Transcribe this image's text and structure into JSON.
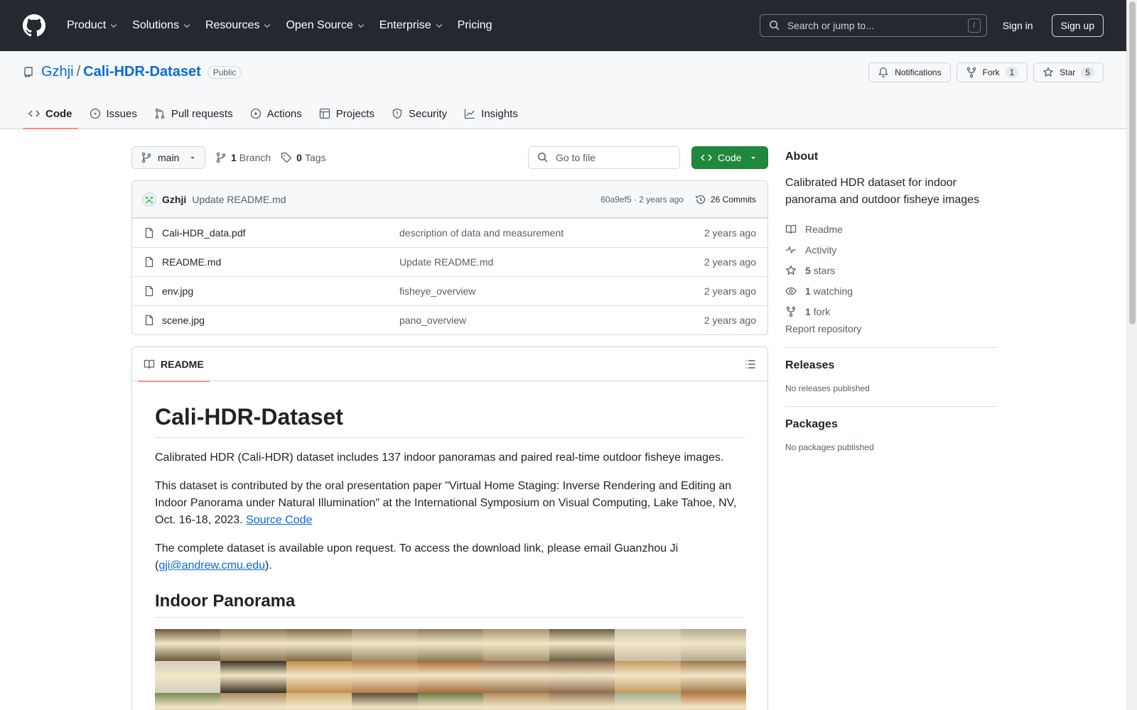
{
  "header": {
    "nav": [
      "Product",
      "Solutions",
      "Resources",
      "Open Source",
      "Enterprise",
      "Pricing"
    ],
    "search_placeholder": "Search or jump to...",
    "search_key": "/",
    "sign_in": "Sign in",
    "sign_up": "Sign up"
  },
  "repo": {
    "owner": "Gzhji",
    "separator": "/",
    "name": "Cali-HDR-Dataset",
    "visibility": "Public",
    "notifications_label": "Notifications",
    "fork_label": "Fork",
    "fork_count": "1",
    "star_label": "Star",
    "star_count": "5",
    "tabs": [
      "Code",
      "Issues",
      "Pull requests",
      "Actions",
      "Projects",
      "Security",
      "Insights"
    ]
  },
  "toolbar": {
    "branch": "main",
    "branch_count": "1",
    "branch_label": "Branch",
    "tag_count": "0",
    "tag_label": "Tags",
    "goto_placeholder": "Go to file",
    "code_label": "Code"
  },
  "latest_commit": {
    "author": "Gzhji",
    "message": "Update README.md",
    "meta": "60a9ef5 · 2 years ago",
    "commits": "26 Commits"
  },
  "files": [
    {
      "name": "Cali-HDR_data.pdf",
      "commit": "description of data and measurement",
      "time": "2 years ago"
    },
    {
      "name": "README.md",
      "commit": "Update README.md",
      "time": "2 years ago"
    },
    {
      "name": "env.jpg",
      "commit": "fisheye_overview",
      "time": "2 years ago"
    },
    {
      "name": "scene.jpg",
      "commit": "pano_overview",
      "time": "2 years ago"
    }
  ],
  "readme": {
    "tab": "README",
    "title": "Cali-HDR-Dataset",
    "p1": "Calibrated HDR (Cali-HDR) dataset includes 137 indoor panoramas and paired real-time outdoor fisheye images.",
    "p2": "This dataset is contributed by the oral presentation paper \"Virtual Home Staging: Inverse Rendering and Editing an Indoor Panorama under Natural Illumination\" at the International Symposium on Visual Computing, Lake Tahoe, NV, Oct. 16-18, 2023.",
    "p2_link": "Source Code",
    "p3_pre": "The complete dataset is available upon request. To access the download link, please email Guanzhou Ji (",
    "p3_link": "gji@andrew.cmu.edu",
    "p3_post": ").",
    "h2": "Indoor Panorama",
    "pano_colors": [
      "#6b5a3c",
      "#8a7450",
      "#7d6a48",
      "#9a8a6a",
      "#8c7c5c",
      "#a8946c",
      "#6e5e42",
      "#c9bfa9",
      "#b4aa94",
      "#d6cfbf",
      "#3a3022",
      "#c28c48",
      "#b47c44",
      "#a86a36",
      "#96704a",
      "#8c6c4c",
      "#c49a5c",
      "#a07848",
      "#7a8a4c",
      "#a88a5c",
      "#d2b27c",
      "#5a4a3a",
      "#6c7a44",
      "#b48c5c",
      "#9a7a5a",
      "#a4b08c",
      "#b87a44"
    ]
  },
  "sidebar": {
    "about_title": "About",
    "description": "Calibrated HDR dataset for indoor panorama and outdoor fisheye images",
    "readme": "Readme",
    "activity": "Activity",
    "stars_count": "5",
    "stars": "stars",
    "watching_count": "1",
    "watching": "watching",
    "forks_count": "1",
    "forks": "fork",
    "report": "Report repository",
    "releases_title": "Releases",
    "releases_text": "No releases published",
    "packages_title": "Packages",
    "packages_text": "No packages published"
  }
}
